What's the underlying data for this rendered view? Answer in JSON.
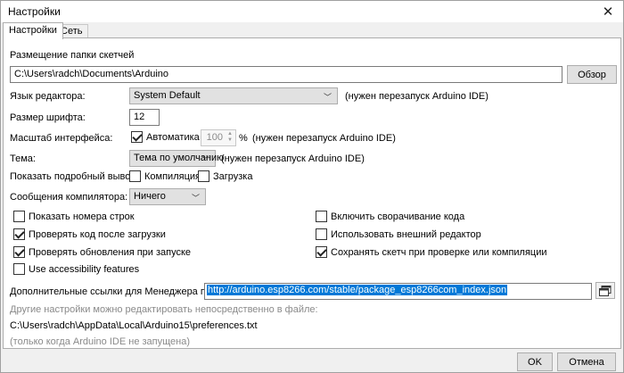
{
  "window": {
    "title": "Настройки"
  },
  "tabs": [
    {
      "label": "Настройки",
      "active": true
    },
    {
      "label": "Сеть",
      "active": false
    }
  ],
  "sketchbook": {
    "label": "Размещение папки скетчей",
    "path": "C:\\Users\\radch\\Documents\\Arduino",
    "browse_label": "Обзор"
  },
  "editor_language": {
    "label": "Язык редактора:",
    "value": "System Default",
    "note": "(нужен перезапуск Arduino IDE)"
  },
  "font_size": {
    "label": "Размер шрифта:",
    "value": "12"
  },
  "scale": {
    "label": "Масштаб интерфейса:",
    "auto_label": "Автоматика",
    "auto_checked": true,
    "value": "100",
    "unit": "%",
    "note": "(нужен перезапуск Arduino IDE)"
  },
  "theme": {
    "label": "Тема:",
    "value": "Тема по умолчанию",
    "note": "(нужен перезапуск Arduino IDE)"
  },
  "verbose": {
    "label": "Показать подробный вывод:",
    "compile_label": "Компиляция",
    "compile_checked": false,
    "upload_label": "Загрузка",
    "upload_checked": false
  },
  "warnings": {
    "label": "Сообщения компилятора:",
    "value": "Ничего"
  },
  "options_left": [
    {
      "label": "Показать номера строк",
      "checked": false
    },
    {
      "label": "Проверять код после загрузки",
      "checked": true
    },
    {
      "label": "Проверять обновления при запуске",
      "checked": true
    },
    {
      "label": "Use accessibility features",
      "checked": false
    }
  ],
  "options_right": [
    {
      "label": "Включить сворачивание кода",
      "checked": false
    },
    {
      "label": "Использовать внешний редактор",
      "checked": false
    },
    {
      "label": "Сохранять скетч при проверке или компиляции",
      "checked": true
    }
  ],
  "board_urls": {
    "label": "Дополнительные ссылки для Менеджера плат:",
    "value": "http://arduino.esp8266.com/stable/package_esp8266com_index.json"
  },
  "info": {
    "line1": "Другие настройки можно редактировать непосредственно в файле:",
    "path": "C:\\Users\\radch\\AppData\\Local\\Arduino15\\preferences.txt",
    "line3": "(только когда Arduino IDE не запущена)"
  },
  "footer": {
    "ok_label": "OK",
    "cancel_label": "Отмена"
  }
}
